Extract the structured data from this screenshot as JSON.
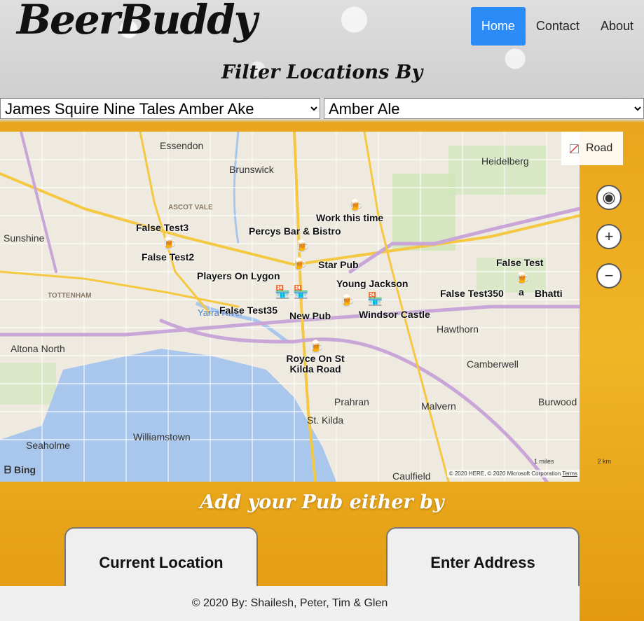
{
  "header": {
    "logo": "BeerBuddy",
    "nav": [
      {
        "label": "Home",
        "active": true
      },
      {
        "label": "Contact"
      },
      {
        "label": "About"
      }
    ]
  },
  "filter": {
    "title": "Filter Locations By",
    "beer_select": {
      "selected": "James Squire Nine Tales Amber Ake"
    },
    "style_select": {
      "selected": "Amber Ale"
    }
  },
  "map": {
    "layer_toggle": "Road",
    "suburbs": [
      "Essendon",
      "Brunswick",
      "Heidelberg",
      "Sunshine",
      "ASCOT VALE",
      "TOTTENHAM",
      "Altona North",
      "Hawthorn",
      "Camberwell",
      "Prahran",
      "Malvern",
      "Burwood Station",
      "St. Kilda",
      "Williamstown",
      "Seaholme",
      "Caulfield",
      "Yarra River"
    ],
    "pubs": [
      "False Test3",
      "False Test2",
      "Work this time",
      "Percys Bar & Bistro",
      "Star Pub",
      "Players On Lygon",
      "Young Jackson",
      "False Test35",
      "New Pub",
      "Windsor Castle",
      "False Test350",
      "False Test",
      "a",
      "Bhatti",
      "Royce On St Kilda Road"
    ],
    "attribution": "© 2020 HERE, © 2020 Microsoft Corporation",
    "terms": "Terms",
    "provider": "Bing",
    "scale_miles": "1 miles",
    "scale_km": "2 km"
  },
  "add_pub": {
    "title": "Add your Pub either by",
    "current_location": "Current Location",
    "enter_address": "Enter Address"
  },
  "footer": {
    "text": "© 2020 By: Shailesh, Peter, Tim & Glen"
  }
}
